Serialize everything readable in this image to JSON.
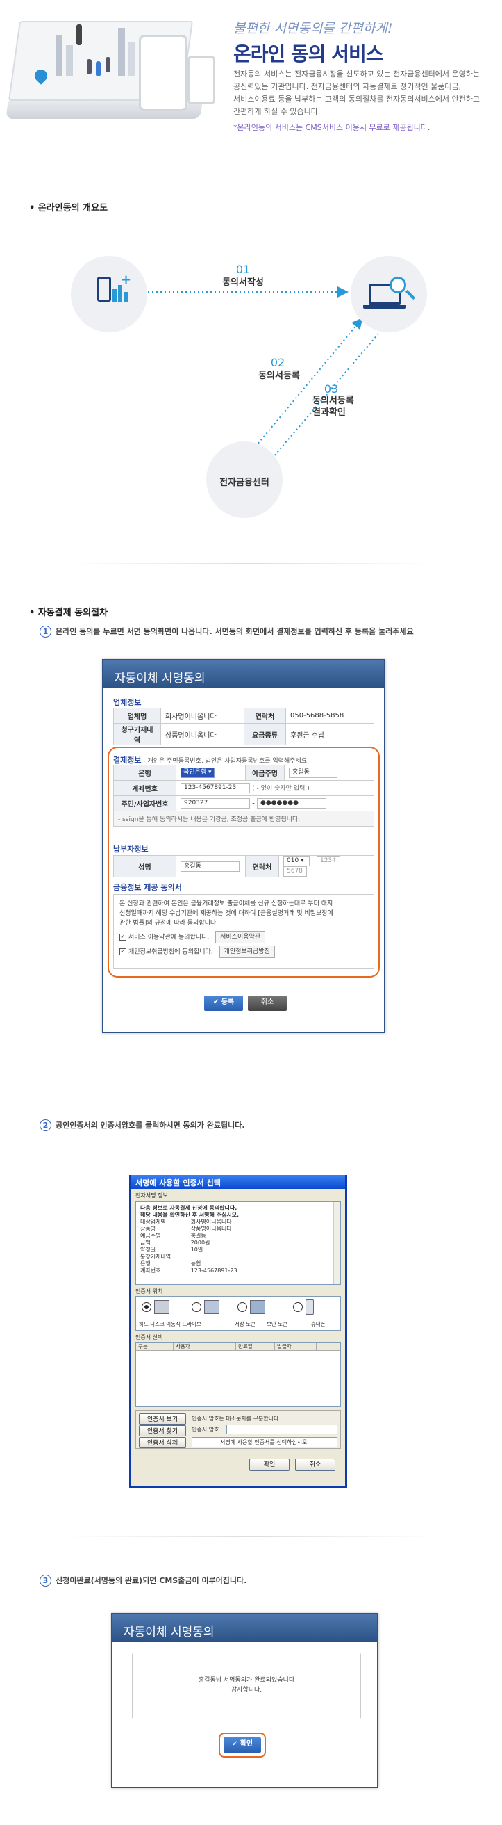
{
  "hero": {
    "slogan": "불편한 서면동의를 간편하게!",
    "title": "온라인 동의 서비스",
    "desc1": "전자동의 서비스는 전자금융시장을 선도하고 있는 전자금융센터에서 운영하는",
    "desc2": "공신력있는 기관입니다. 전자금융센터의 자동결제로 정기적인 물품대금,",
    "desc3": "서비스이용료 등을 납부하는 고객의 동의절차를 전자동의서비스에서 안전하고",
    "desc4": "간편하게 하실 수 있습니다.",
    "note": "*온라인동의 서비스는 CMS서비스 이용시 무료로 제공됩니다."
  },
  "overview": {
    "title": "• 온라인동의 개요도",
    "step1_num": "01",
    "step1_label": "동의서작성",
    "step2_num": "02",
    "step2_label": "동의서등록",
    "step3_num": "03",
    "step3_label1": "동의서등록",
    "step3_label2": "결과확인",
    "center_label": "전자금융센터"
  },
  "process": {
    "title": "• 자동결제 동의절차",
    "step1_num": "1",
    "step1_text": "온라인 동의를 누르면 서면 동의화면이 나옵니다. 서면동의 화면에서 결제정보를 입력하신 후 등록을 눌러주세요",
    "step2_num": "2",
    "step2_text": "공인인증서의 인증서암호를 클릭하시면 동의가 완료됩니다.",
    "step3_num": "3",
    "step3_text": "신청이완료(서명동의 완료)되면 CMS출금이 이루어집니다."
  },
  "form": {
    "title": "자동이체 서명동의",
    "company_section": "업체정보",
    "company_name_label": "업체명",
    "company_name": "회사명이니옵니다",
    "contact_label": "연락처",
    "contact": "050-5688-5858",
    "item_label": "청구기재내역",
    "item": "상품명이니옵니다",
    "fee_label": "요금종류",
    "fee": "후원금 수납",
    "pay_section": "결제정보",
    "pay_note": " - 개인은 주민등록번호, 법인은 사업자등록번호를 입력해주세요.",
    "bank_label": "은행",
    "bank": "국민은행",
    "owner_label": "예금주명",
    "owner": "홍길동",
    "account_label": "계좌번호",
    "account": "123-4567891-23",
    "account_hint": "( - 없이 숫자만 입력 )",
    "id_label": "주민/사업자번호",
    "id_front": "920327",
    "id_back": "●●●●●●●",
    "ssign_note": " - ssign을 통해 동의하시는 내용은 기강곰, 조정곰 출금에 반영됩니다.",
    "payer_section": "납부자정보",
    "payer_name_label": "성명",
    "payer_name": "홍길동",
    "payer_phone_label": "연락처",
    "phone1": "010",
    "phone2": "1234",
    "phone3": "5678",
    "consent_section": "금융정보 제공 동의서",
    "consent_text1": "본 신청과 관련하여 본인은 금융거래정보 출금이체를 신규 신청하는대로 부터 해지",
    "consent_text2": "신청일때까지 해당 수납기관에 제공하는 것에 대하여 [금융실명거래 및 비밀보장에",
    "consent_text3": "관한 법률]의 규정에 따라 동의합니다.",
    "agree1": "서비스 이용약관에 동의합니다.",
    "agree1_btn": "서비스이용약관",
    "agree2": "개인정보취급방침에 동의합니다.",
    "agree2_btn": "개인정보취급방침",
    "submit": "등록",
    "cancel": "취소"
  },
  "cert": {
    "title": "서명에 사용할 인증서 선택",
    "info_label": "전자서명 정보",
    "line1": "다음 정보로 자동결제 신청에 동의합니다.",
    "line2": "해당 내용을 확인하신 후 서명해 주십시오.",
    "rows": [
      {
        "k": "대상업체명",
        "v": ":회사명이니옵니다"
      },
      {
        "k": "상품명",
        "v": ":상품명이니옵니다"
      },
      {
        "k": "예금주명",
        "v": ":홍길동"
      },
      {
        "k": "금액",
        "v": ":2000원"
      },
      {
        "k": "약정일",
        "v": ":10일"
      },
      {
        "k": "통장기재내역",
        "v": ":"
      },
      {
        "k": "은행",
        "v": ":농협"
      },
      {
        "k": "계좌번호",
        "v": ":123-4567891-23"
      }
    ],
    "location_label": "인증서 위치",
    "loc1": "하드 디스크 이동식 드라이브",
    "loc2": "저장 토큰",
    "loc3": "보안 토큰",
    "loc4": "휴대폰",
    "select_label": "인증서 선택",
    "col1": "구분",
    "col2": "사용자",
    "col3": "만료일",
    "col4": "발급자",
    "btn_view": "인증서 보기",
    "btn_find": "인증서 찾기",
    "btn_delete": "인증서 삭제",
    "pw_hint": "인증서 암호는 대소문자를 구분합니다.",
    "pw_label": "인증서 암호",
    "status": "서명에 사용할 인증서를 선택하십시오.",
    "ok": "확인",
    "cancel": "취소"
  },
  "done": {
    "title": "자동이체 서명동의",
    "msg1": "홍길동님 서명동의가 완료되었습니다",
    "msg2": "감사합니다.",
    "ok": "확인"
  }
}
